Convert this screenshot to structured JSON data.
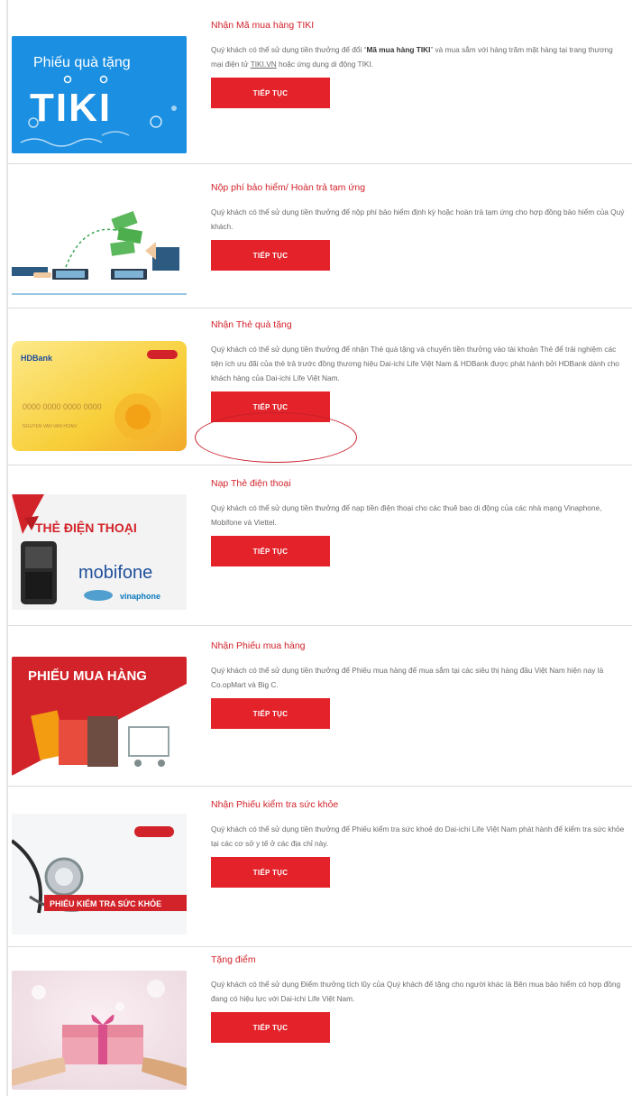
{
  "cards": [
    {
      "title": "Nhận Mã mua hàng TIKI",
      "desc_pre": "Quý khách có thể sử dụng tiền thưởng để đổi “",
      "desc_bold": "Mã mua hàng TIKI",
      "desc_mid": "” và mua sắm với hàng trăm mặt hàng tại trang thương mại điện tử ",
      "desc_link": "TIKI.VN",
      "desc_post": " hoặc ứng dụng di động TIKI.",
      "button": "TIẾP TỤC",
      "image_text_1": "Phiếu quà tặng",
      "image_text_2": "TIKI"
    },
    {
      "title": "Nộp phí bảo hiểm/ Hoàn trả tạm ứng",
      "desc": "Quý khách có thể sử dụng tiền thưởng để nộp phí bảo hiểm định kỳ hoặc hoàn trả tạm ứng cho hợp đồng bảo hiểm của Quý khách.",
      "button": "TIẾP TỤC"
    },
    {
      "title": "Nhận Thẻ quà tặng",
      "desc": "Quý khách có thể sử dụng tiền thưởng để nhận Thẻ quà tặng và chuyển tiền thưởng vào tài khoản Thẻ để trải nghiệm các tiện ích ưu đãi của thẻ trả trước đồng thương hiệu Dai-ichi Life Việt Nam & HDBank được phát hành bởi HDBank dành cho khách hàng của Dai-ichi Life Việt Nam.",
      "button": "TIẾP TỤC",
      "image_text_1": "HDBank",
      "image_text_2": "0000 0000 0000 0000",
      "image_text_3": "NGUYEN VAN VAN HOAN"
    },
    {
      "title": "Nạp Thẻ điện thoại",
      "desc": "Quý khách có thể sử dụng tiền thưởng để nạp tiền điện thoại cho các thuê bao di động của các nhà mạng Vinaphone, Mobifone và Viettel.",
      "button": "TIẾP TỤC",
      "image_text_1": "THẺ ĐIỆN THOẠI",
      "image_text_2": "mobifone",
      "image_text_3": "vinaphone"
    },
    {
      "title": "Nhận Phiếu mua hàng",
      "desc": "Quý khách có thể sử dụng tiền thưởng để Phiếu mua hàng để mua sắm tại các siêu thị hàng đầu Việt Nam hiện nay là Co.opMart và Big C.",
      "button": "TIẾP TỤC",
      "image_text_1": "PHIẾU MUA HÀNG"
    },
    {
      "title": "Nhận Phiếu kiểm tra sức khỏe",
      "desc": "Quý khách có thể sử dụng tiền thưởng để Phiếu kiểm tra sức khoẻ do Dai-ichi Life Việt Nam phát hành để kiểm tra sức khỏe tại các cơ sở y tế ở các địa chỉ này.",
      "button": "TIẾP TỤC",
      "image_text_1": "PHIẾU KIỂM TRA SỨC KHỎE"
    },
    {
      "title": "Tặng điểm",
      "desc": "Quý khách có thể sử dụng Điểm thưởng tích lũy của Quý khách để tặng cho người khác là Bên mua bảo hiểm có hợp đồng đang có hiệu lực với Dai-ichi Life Việt Nam.",
      "button": "TIẾP TỤC"
    }
  ],
  "colors": {
    "accent": "#d2232a",
    "button": "#e3222a",
    "tiki_blue": "#1a8fe3",
    "divider": "#dcdcdc"
  }
}
